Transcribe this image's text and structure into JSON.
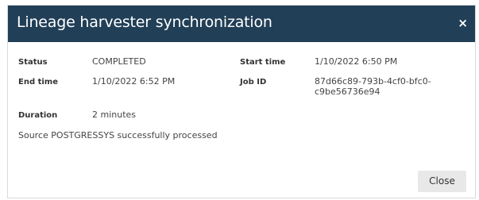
{
  "dialog": {
    "title": "Lineage harvester synchronization",
    "close_icon": "×",
    "fields": {
      "status_label": "Status",
      "status_value": "COMPLETED",
      "start_label": "Start time",
      "start_value": "1/10/2022 6:50 PM",
      "end_label": "End time",
      "end_value": "1/10/2022 6:52 PM",
      "job_label": "Job ID",
      "job_value_line1": "87d66c89-793b-4cf0-bfc0-",
      "job_value_line2": "c9be56736e94",
      "duration_label": "Duration",
      "duration_value": "2 minutes"
    },
    "message": "Source POSTGRESSYS successfully processed",
    "close_button": "Close"
  },
  "colors": {
    "header_bg": "#213f57",
    "button_bg": "#e8e8e8"
  }
}
